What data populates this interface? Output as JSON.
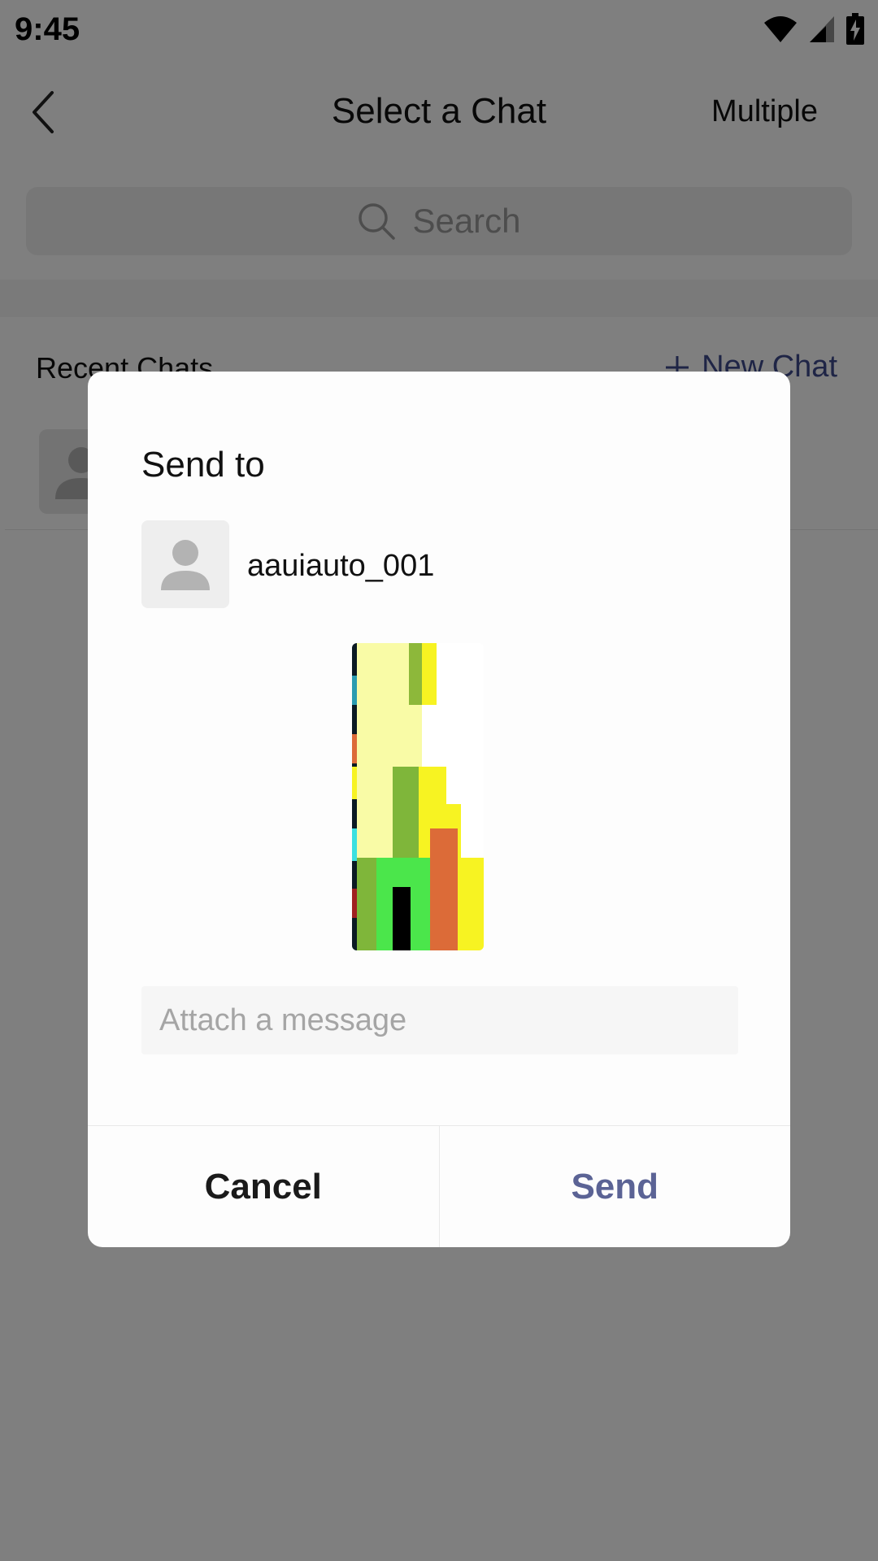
{
  "status_bar": {
    "time": "9:45",
    "icons": [
      "wifi-icon",
      "cellular-signal-icon",
      "battery-charging-icon"
    ]
  },
  "app_bar": {
    "title": "Select a Chat",
    "multiple_label": "Multiple",
    "back_icon": "chevron-left-icon"
  },
  "search": {
    "placeholder": "Search",
    "icon": "search-icon"
  },
  "recent": {
    "section_label": "Recent Chats",
    "new_chat_label": "New Chat",
    "new_chat_icon": "plus-icon"
  },
  "dialog": {
    "title": "Send to",
    "recipient": {
      "name": "aauiauto_001",
      "avatar_icon": "person-silhouette-icon"
    },
    "message_placeholder": "Attach a message",
    "cancel_label": "Cancel",
    "send_label": "Send"
  },
  "colors": {
    "accent": "#5b6395",
    "new_chat": "#3f4a8c",
    "scrim": "rgba(0,0,0,0.5)"
  }
}
